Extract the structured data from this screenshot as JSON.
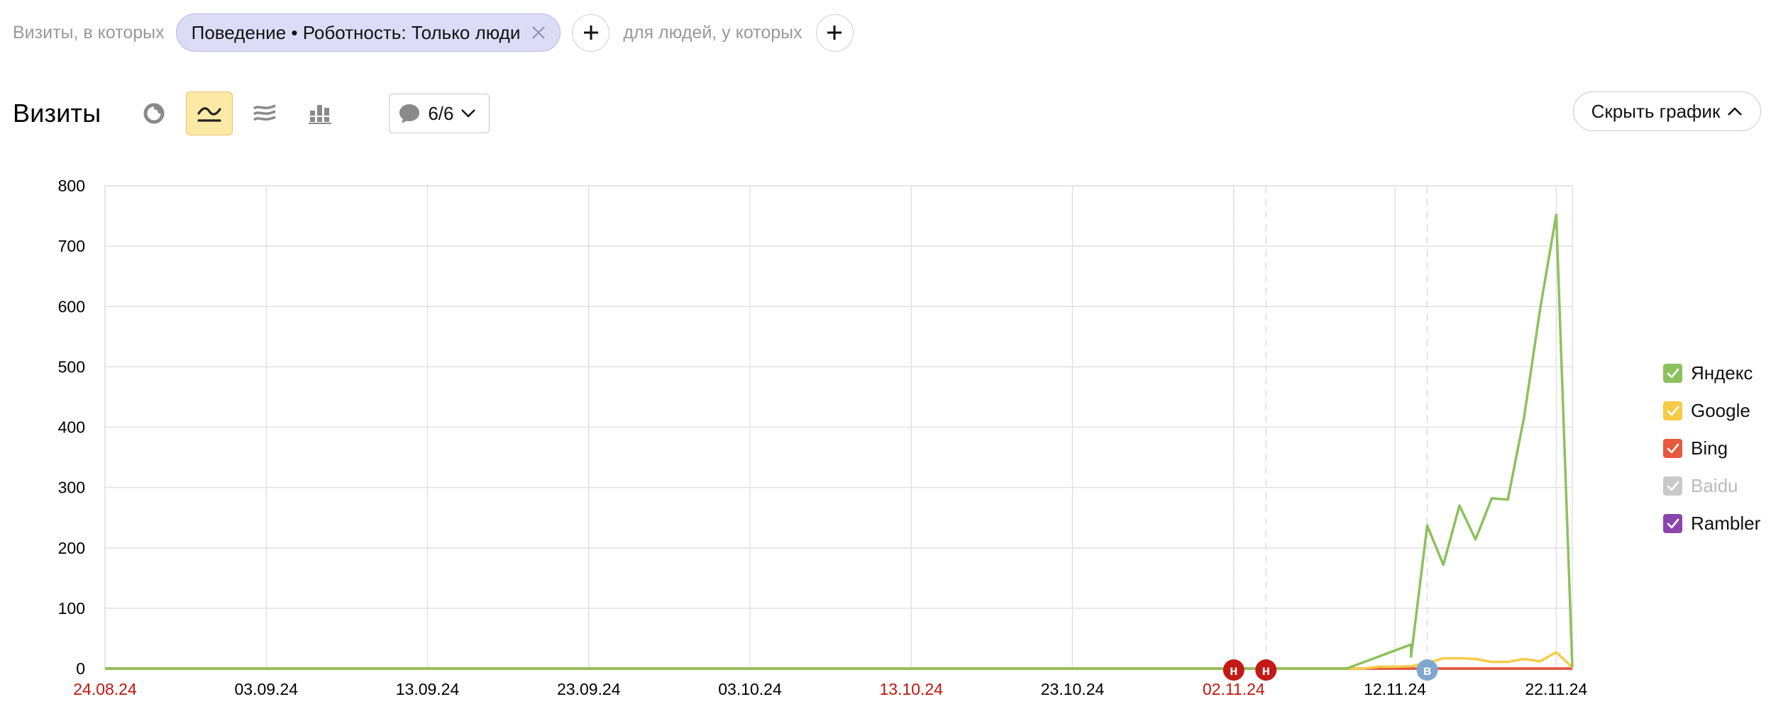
{
  "filter": {
    "visits_label": "Визиты, в которых",
    "chip_label": "Поведение • Роботность: Только люди",
    "people_label": "для людей, у которых"
  },
  "toolbar": {
    "title": "Визиты",
    "chart_types": [
      "pie-chart-icon",
      "line-chart-icon",
      "area-chart-icon",
      "stacked-bar-icon"
    ],
    "active_chart_type": "line-chart-icon",
    "comments_count": "6/6",
    "hide_chart_label": "Скрыть график"
  },
  "legend": [
    {
      "name": "Яндекс",
      "color": "#8dc15c",
      "checked": true,
      "dimmed": false
    },
    {
      "name": "Google",
      "color": "#f6cb48",
      "checked": true,
      "dimmed": false
    },
    {
      "name": "Bing",
      "color": "#e8583b",
      "checked": true,
      "dimmed": false
    },
    {
      "name": "Baidu",
      "color": "#c9c9c9",
      "checked": true,
      "dimmed": true
    },
    {
      "name": "Rambler",
      "color": "#8e44ad",
      "checked": true,
      "dimmed": false
    }
  ],
  "chart_data": {
    "type": "line",
    "ylim": [
      0,
      800
    ],
    "yticks": [
      0,
      100,
      200,
      300,
      400,
      500,
      600,
      700,
      800
    ],
    "xlim": [
      "24.08.24",
      "23.11.24"
    ],
    "xticks": [
      {
        "label": "24.08.24",
        "red": true
      },
      {
        "label": "03.09.24",
        "red": false
      },
      {
        "label": "13.09.24",
        "red": false
      },
      {
        "label": "23.09.24",
        "red": false
      },
      {
        "label": "03.10.24",
        "red": false
      },
      {
        "label": "13.10.24",
        "red": true
      },
      {
        "label": "23.10.24",
        "red": false
      },
      {
        "label": "02.11.24",
        "red": true
      },
      {
        "label": "12.11.24",
        "red": false
      },
      {
        "label": "22.11.24",
        "red": false
      }
    ],
    "grid": true,
    "legend_position": "right",
    "annotations": [
      {
        "date": "02.11.24",
        "letter": "н",
        "color": "#c41a15"
      },
      {
        "date": "04.11.24",
        "letter": "н",
        "color": "#c41a15"
      },
      {
        "date": "14.11.24",
        "letter": "в",
        "color": "#7fa7cf"
      }
    ],
    "series": [
      {
        "name": "Яндекс",
        "color": "#8dc15c",
        "points": [
          [
            "24.08.24",
            0
          ],
          [
            "09.11.24",
            0
          ],
          [
            "10.11.24",
            10
          ],
          [
            "11.11.24",
            20
          ],
          [
            "12.11.24",
            30
          ],
          [
            "13.11.24",
            40
          ],
          [
            "13.11.24",
            20
          ],
          [
            "14.11.24",
            237
          ],
          [
            "15.11.24",
            172
          ],
          [
            "16.11.24",
            270
          ],
          [
            "17.11.24",
            214
          ],
          [
            "18.11.24",
            282
          ],
          [
            "19.11.24",
            280
          ],
          [
            "20.11.24",
            415
          ],
          [
            "21.11.24",
            595
          ],
          [
            "22.11.24",
            752
          ],
          [
            "23.11.24",
            2
          ]
        ]
      },
      {
        "name": "Google",
        "color": "#f6cb48",
        "points": [
          [
            "24.08.24",
            0
          ],
          [
            "10.11.24",
            0
          ],
          [
            "11.11.24",
            3
          ],
          [
            "12.11.24",
            3
          ],
          [
            "13.11.24",
            4
          ],
          [
            "14.11.24",
            9
          ],
          [
            "15.11.24",
            17
          ],
          [
            "16.11.24",
            17
          ],
          [
            "17.11.24",
            16
          ],
          [
            "18.11.24",
            11
          ],
          [
            "19.11.24",
            11
          ],
          [
            "20.11.24",
            16
          ],
          [
            "21.11.24",
            12
          ],
          [
            "22.11.24",
            27
          ],
          [
            "23.11.24",
            2
          ]
        ]
      },
      {
        "name": "Bing",
        "color": "#e8583b",
        "points": [
          [
            "24.08.24",
            0
          ],
          [
            "23.11.24",
            0
          ]
        ]
      },
      {
        "name": "Rambler",
        "color": "#8e44ad",
        "points": [
          [
            "24.08.24",
            0
          ],
          [
            "23.11.24",
            0
          ]
        ]
      }
    ]
  }
}
